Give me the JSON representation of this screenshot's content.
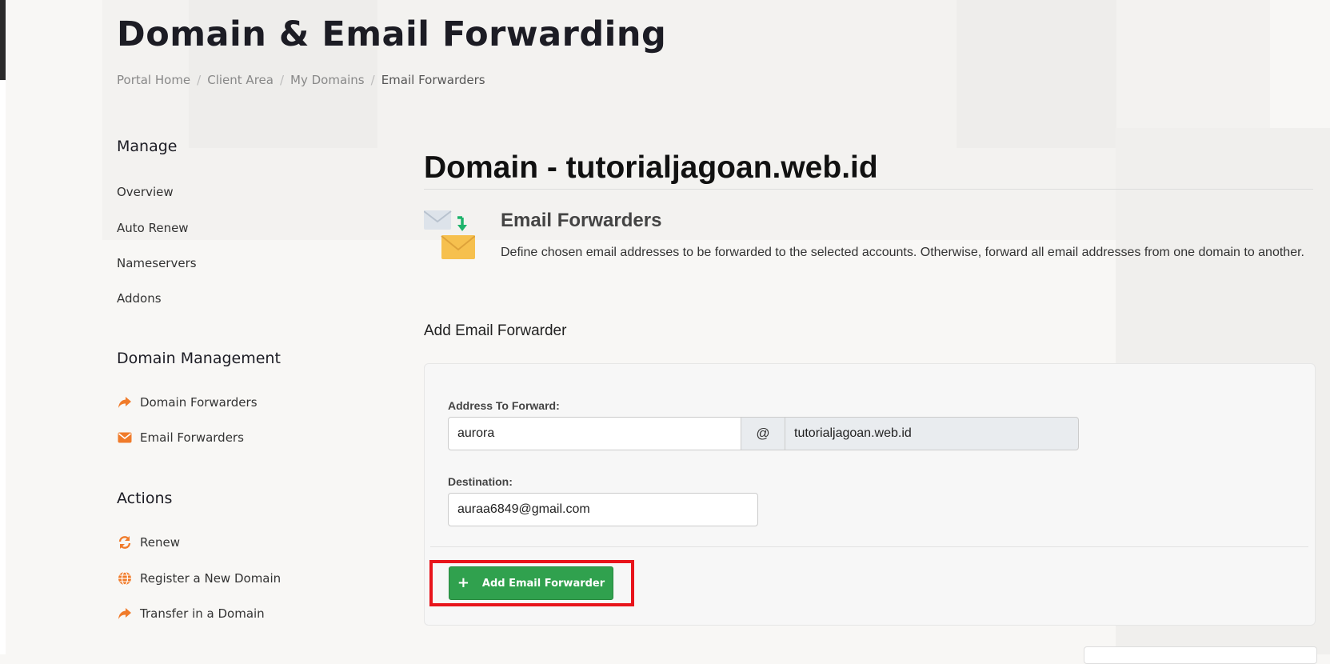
{
  "page": {
    "title": "Domain & Email Forwarding"
  },
  "breadcrumb": [
    "Portal Home",
    "Client Area",
    "My Domains",
    "Email Forwarders"
  ],
  "sidebar": {
    "manage": {
      "heading": "Manage",
      "items": [
        "Overview",
        "Auto Renew",
        "Nameservers",
        "Addons"
      ]
    },
    "domain_management": {
      "heading": "Domain Management",
      "items": [
        {
          "label": "Domain Forwarders",
          "icon": "share-arrow-icon"
        },
        {
          "label": "Email Forwarders",
          "icon": "envelope-icon"
        }
      ]
    },
    "actions": {
      "heading": "Actions",
      "items": [
        {
          "label": "Renew",
          "icon": "refresh-icon"
        },
        {
          "label": "Register a New Domain",
          "icon": "globe-icon"
        },
        {
          "label": "Transfer in a Domain",
          "icon": "share-arrow-icon"
        }
      ]
    },
    "accent_color": "#f07b2a"
  },
  "main": {
    "domain_title": "Domain - tutorialjagoan.web.id",
    "section_heading": "Email Forwarders",
    "section_description": "Define chosen email addresses to be forwarded to the selected accounts. Otherwise, forward all email addresses from one domain to another.",
    "add_heading": "Add Email Forwarder",
    "form": {
      "address_label": "Address To Forward:",
      "address_value": "aurora",
      "at_symbol": "@",
      "domain_value": "tutorialjagoan.web.id",
      "destination_label": "Destination:",
      "destination_value": "auraa6849@gmail.com",
      "submit_label": "Add Email Forwarder",
      "submit_color": "#30a14e"
    },
    "highlight_color": "#e8141b"
  }
}
